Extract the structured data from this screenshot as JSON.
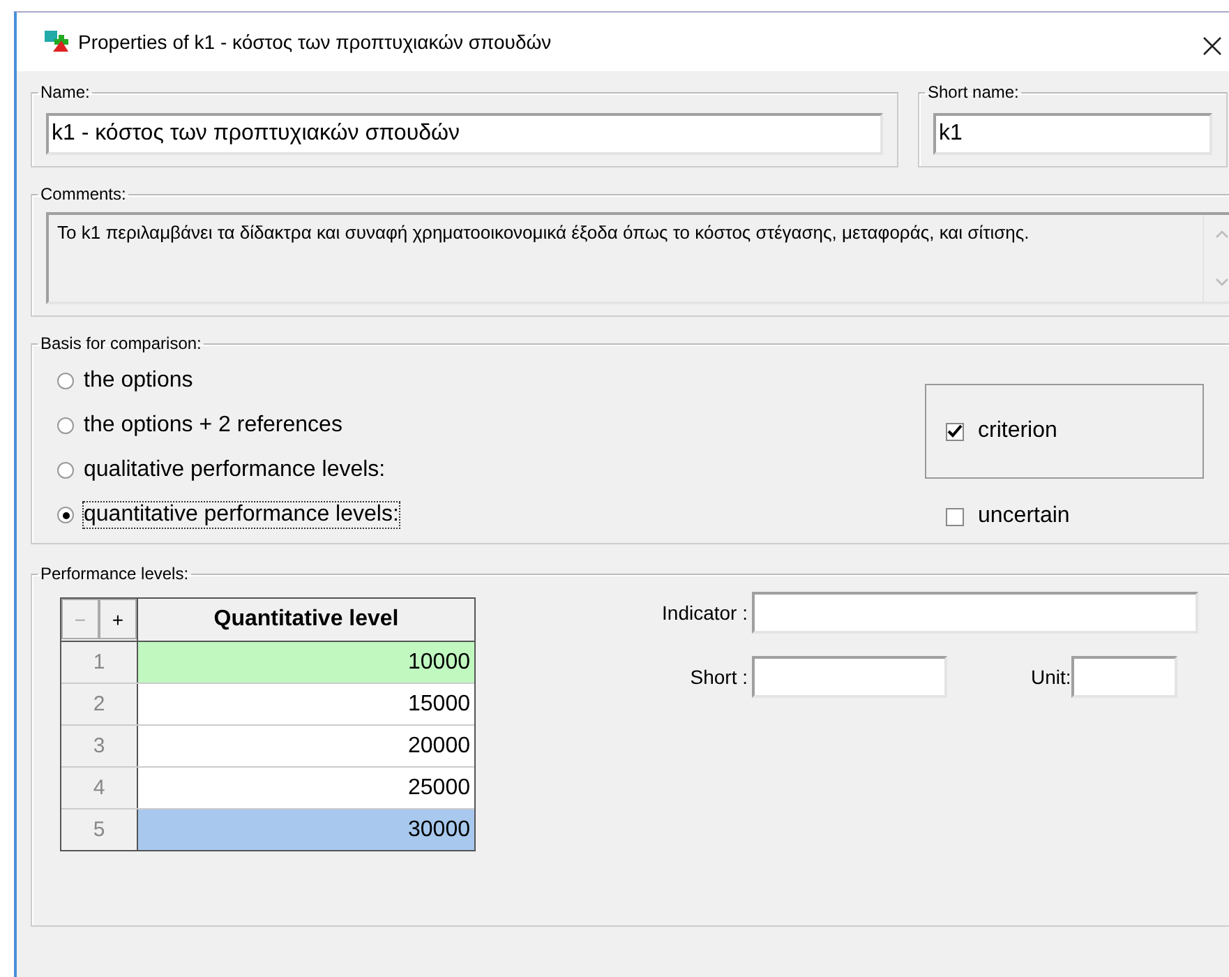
{
  "window": {
    "title": "Properties of  k1 - κόστος των προπτυχιακών σπουδών"
  },
  "name": {
    "label": "Name:",
    "value": "k1 - κόστος των προπτυχιακών σπουδών"
  },
  "short_name": {
    "label": "Short name:",
    "value": "k1"
  },
  "comments": {
    "label": "Comments:",
    "value": "Το k1 περιλαμβάνει τα δίδακτρα και συναφή χρηματοοικονομικά έξοδα όπως το κόστος στέγασης, μεταφοράς, και σίτισης."
  },
  "basis": {
    "label": "Basis for comparison:",
    "options": [
      {
        "label": "the options",
        "selected": false
      },
      {
        "label": "the options + 2 references",
        "selected": false
      },
      {
        "label": "qualitative performance levels:",
        "selected": false
      },
      {
        "label": "quantitative performance levels:",
        "selected": true
      }
    ],
    "criterion": {
      "label": "criterion",
      "checked": true
    },
    "uncertain": {
      "label": "uncertain",
      "checked": false
    }
  },
  "performance": {
    "label": "Performance levels:",
    "remove_button": {
      "label": "−",
      "disabled": true
    },
    "add_button": {
      "label": "+",
      "disabled": false
    },
    "column": "Quantitative level",
    "rows": [
      {
        "index": "1",
        "value": "10000",
        "color": "#c0f8c0"
      },
      {
        "index": "2",
        "value": "15000",
        "color": "#ffffff"
      },
      {
        "index": "3",
        "value": "20000",
        "color": "#ffffff"
      },
      {
        "index": "4",
        "value": "25000",
        "color": "#ffffff"
      },
      {
        "index": "5",
        "value": "30000",
        "color": "#a8c8ee"
      }
    ],
    "indicator_label": "Indicator :",
    "short_label": "Short :",
    "unit_label": "Unit:"
  }
}
